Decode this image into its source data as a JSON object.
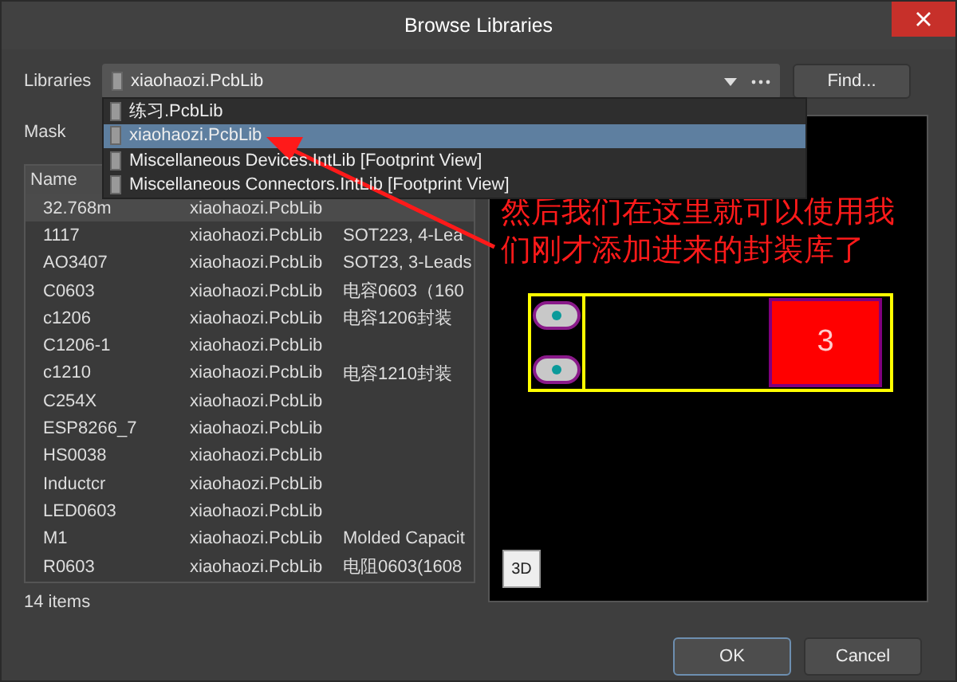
{
  "window": {
    "title": "Browse Libraries"
  },
  "libraries": {
    "label": "Libraries",
    "value": "xiaohaozi.PcbLib",
    "options": [
      {
        "label": "练习.PcbLib",
        "selected": false
      },
      {
        "label": "xiaohaozi.PcbLib",
        "selected": true
      },
      {
        "label": "Miscellaneous Devices.IntLib [Footprint View]",
        "selected": false
      },
      {
        "label": "Miscellaneous Connectors.IntLib [Footprint View]",
        "selected": false
      }
    ]
  },
  "find_button": "Find...",
  "mask": {
    "label": "Mask"
  },
  "table": {
    "columns": [
      "Name"
    ],
    "rows": [
      {
        "cells": [
          "32.768m",
          "xiaohaozi.PcbLib",
          ""
        ],
        "selected": true
      },
      {
        "cells": [
          "1117",
          "xiaohaozi.PcbLib",
          "SOT223, 4-Lea"
        ],
        "selected": false
      },
      {
        "cells": [
          "AO3407",
          "xiaohaozi.PcbLib",
          "SOT23, 3-Leads"
        ],
        "selected": false
      },
      {
        "cells": [
          "C0603",
          "xiaohaozi.PcbLib",
          "电容0603（160"
        ],
        "selected": false
      },
      {
        "cells": [
          "c1206",
          "xiaohaozi.PcbLib",
          "电容1206封装"
        ],
        "selected": false
      },
      {
        "cells": [
          "C1206-1",
          "xiaohaozi.PcbLib",
          ""
        ],
        "selected": false
      },
      {
        "cells": [
          "c1210",
          "xiaohaozi.PcbLib",
          "电容1210封装"
        ],
        "selected": false
      },
      {
        "cells": [
          "C254X",
          "xiaohaozi.PcbLib",
          ""
        ],
        "selected": false
      },
      {
        "cells": [
          "ESP8266_7",
          "xiaohaozi.PcbLib",
          ""
        ],
        "selected": false
      },
      {
        "cells": [
          "HS0038",
          "xiaohaozi.PcbLib",
          ""
        ],
        "selected": false
      },
      {
        "cells": [
          "Inductcr",
          "xiaohaozi.PcbLib",
          ""
        ],
        "selected": false
      },
      {
        "cells": [
          "LED0603",
          "xiaohaozi.PcbLib",
          ""
        ],
        "selected": false
      },
      {
        "cells": [
          "M1",
          "xiaohaozi.PcbLib",
          "Molded Capacit"
        ],
        "selected": false
      },
      {
        "cells": [
          "R0603",
          "xiaohaozi.PcbLib",
          "电阻0603(1608"
        ],
        "selected": false
      }
    ]
  },
  "status": "14 items",
  "preview": {
    "annotation": "然后我们在这里就可以使用我们刚才添加进来的封装库了",
    "pad_label": "3",
    "view_button": "3D"
  },
  "buttons": [
    "OK",
    "Cancel"
  ]
}
